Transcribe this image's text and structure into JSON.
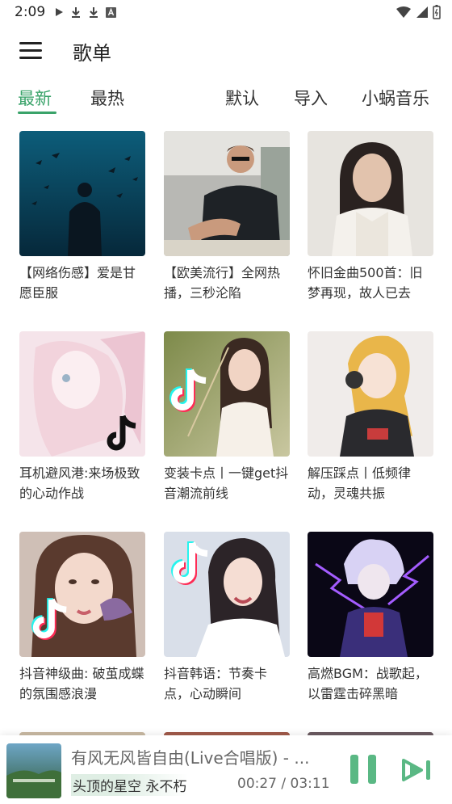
{
  "status_bar": {
    "time": "2:09"
  },
  "app_bar": {
    "title": "歌单"
  },
  "tabs": [
    {
      "label": "最新",
      "active": true
    },
    {
      "label": "最热",
      "active": false
    },
    {
      "label": "默认",
      "active": false
    },
    {
      "label": "导入",
      "active": false
    },
    {
      "label": "小蜗音乐",
      "active": false
    }
  ],
  "playlists": [
    {
      "title": "【网络伤感】爱是甘愿臣服",
      "cover": "birds-silhouette"
    },
    {
      "title": "【欧美流行】全网热播，三秒沦陷",
      "cover": "man-sunglasses"
    },
    {
      "title": "怀旧金曲500首：旧梦再现，故人已去",
      "cover": "vintage-woman"
    },
    {
      "title": "耳机避风港:来场极致的心动作战",
      "cover": "anime-pink-tiktok"
    },
    {
      "title": "变装卡点丨一键get抖音潮流前线",
      "cover": "girl-tiktok"
    },
    {
      "title": "解压踩点丨低频律动，灵魂共振",
      "cover": "anime-headphones"
    },
    {
      "title": "抖音神级曲: 破茧成蝶的氛围感浪漫",
      "cover": "girl-butterfly-tiktok"
    },
    {
      "title": "抖音韩语：节奏卡点，心动瞬间",
      "cover": "kpop-girl-tiktok"
    },
    {
      "title": "高燃BGM：战歌起，以雷霆击碎黑暗",
      "cover": "anime-lightning"
    }
  ],
  "player": {
    "song": "有风无风皆自由(Live合唱版) - ...",
    "lyric": "头顶的星空 永不朽",
    "time": "00:27 / 03:11",
    "progress": 0.14
  },
  "colors": {
    "accent": "#3aa36a",
    "player_button": "#5ab884"
  }
}
